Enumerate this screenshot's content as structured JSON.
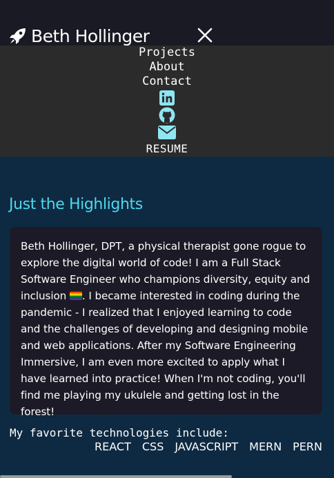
{
  "header": {
    "brand_name": "Beth Hollinger",
    "logo_icon": "rocket-icon",
    "close_icon": "close-icon"
  },
  "menu": {
    "links": [
      "Projects",
      "About",
      "Contact"
    ],
    "social_icons": [
      "linkedin-icon",
      "github-icon",
      "envelope-icon"
    ],
    "resume_label": "RESUME"
  },
  "highlights": {
    "heading": "Just the Highlights",
    "bio_part1": "Beth Hollinger, DPT, a physical therapist gone rogue to explore the digital world of code! I am a Full Stack Software Engineer who champions diversity, equity and inclusion ",
    "bio_part2": ". I became interested in coding during the pandemic - I realized that I enjoyed learning to code and the challenges of developing and designing mobile and web applications. After my Software Engineering Immersive, I am even more excited to apply what I have learned into practice! When I'm not coding, you'll find me playing my ukulele and getting lost in the forest!"
  },
  "technologies": {
    "label": "My favorite technologies include:",
    "items": [
      "REACT",
      "CSS",
      "JAVASCRIPT",
      "MERN",
      "PERN"
    ]
  },
  "colors": {
    "accent": "#4ed8ee",
    "page_bg": "#0e2a42",
    "header_bg": "#1a1a24",
    "menu_bg": "#2b2b2b",
    "card_bg": "#1c1a26"
  }
}
